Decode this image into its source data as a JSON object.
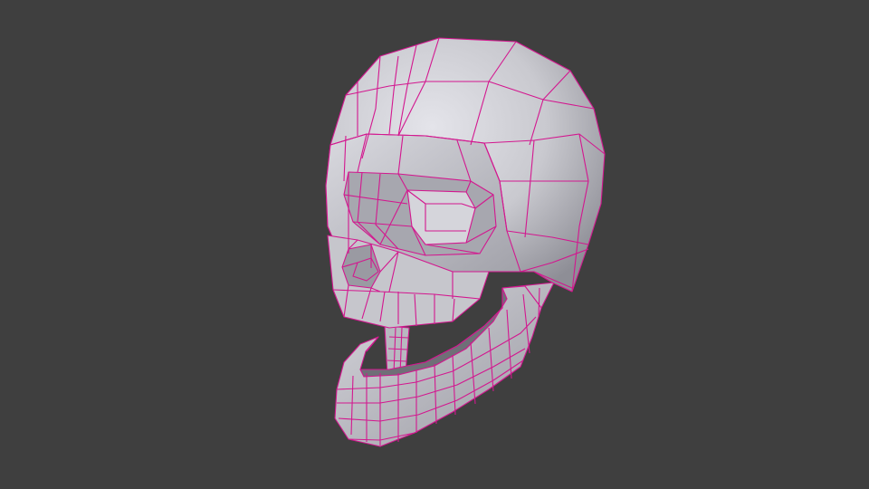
{
  "viewport": {
    "background": "#3f3f3f",
    "object": "skull-mesh",
    "shading": "solid",
    "overlay": "wireframe",
    "wire_color": "#d3178f"
  },
  "mesh": {
    "base_color": "#c9c9cf",
    "highlight_color": "#e4e4ea",
    "shadow_color": "#8e8e96"
  }
}
